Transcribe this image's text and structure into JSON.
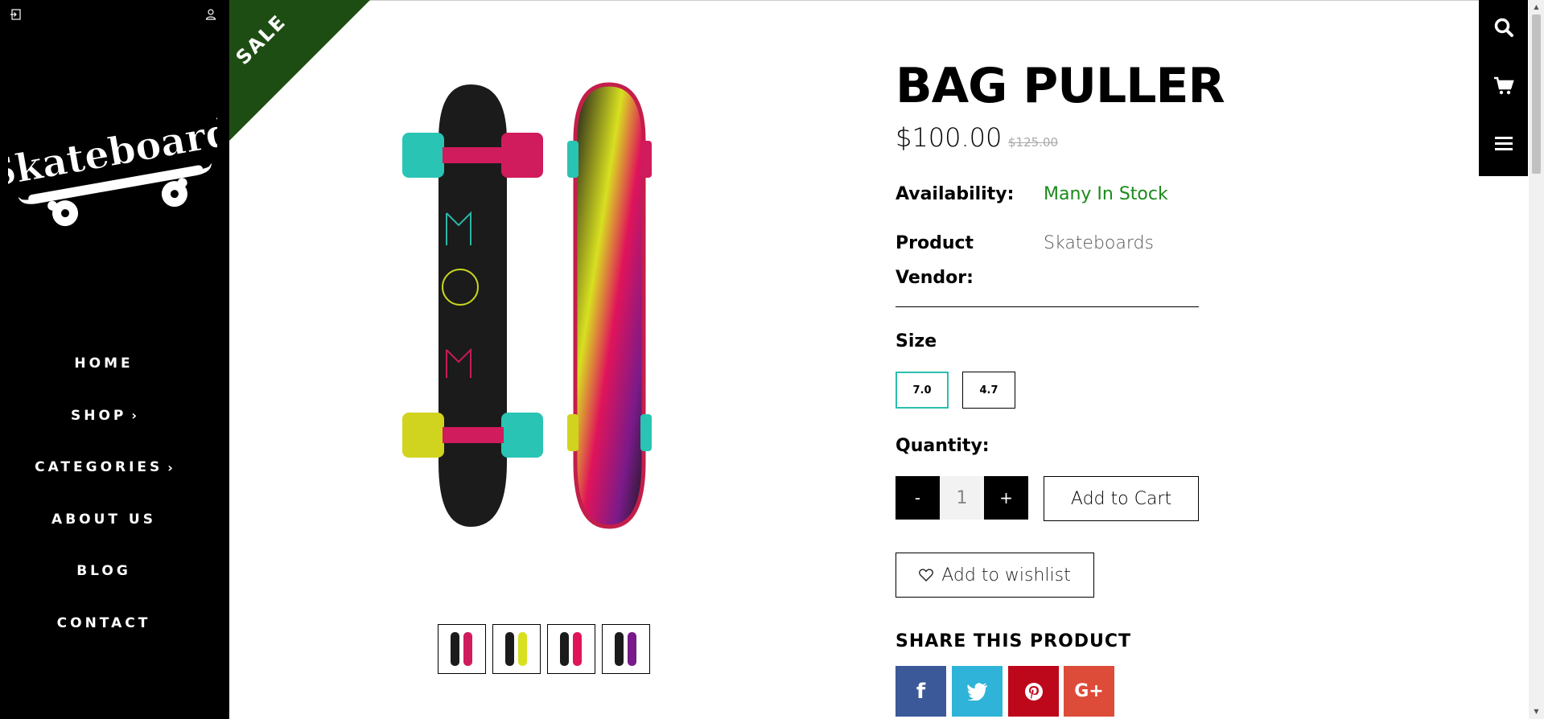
{
  "sidebar": {
    "logo_text": "Skateboard",
    "nav": [
      {
        "label": "HOME",
        "has_submenu": false
      },
      {
        "label": "SHOP",
        "has_submenu": true
      },
      {
        "label": "CATEGORIES",
        "has_submenu": true
      },
      {
        "label": "ABOUT US",
        "has_submenu": false
      },
      {
        "label": "BLOG",
        "has_submenu": false
      },
      {
        "label": "CONTACT",
        "has_submenu": false
      }
    ],
    "icons": [
      "login-icon",
      "user-icon"
    ]
  },
  "ribbon": {
    "text": "SALE",
    "color": "#1e4d14"
  },
  "product": {
    "title": "BAG PULLER",
    "price": "$100.00",
    "old_price": "$125.00",
    "availability_label": "Availability:",
    "availability_value": "Many In Stock",
    "vendor_label": "Product Vendor:",
    "vendor_value": "Skateboards",
    "size_label": "Size",
    "sizes": [
      {
        "label": "7.0",
        "selected": true
      },
      {
        "label": "4.7",
        "selected": false
      }
    ],
    "quantity_label": "Quantity:",
    "quantity_value": "1",
    "minus_label": "-",
    "plus_label": "+",
    "add_to_cart": "Add to Cart",
    "add_to_wishlist": "Add to wishlist",
    "share_title": "SHARE THIS PRODUCT",
    "social": [
      {
        "name": "facebook",
        "glyph": "f",
        "color": "#3b5998"
      },
      {
        "name": "twitter",
        "glyph": "t",
        "color": "#2fb3d8"
      },
      {
        "name": "pinterest",
        "glyph": "p",
        "color": "#bd081c"
      },
      {
        "name": "google-plus",
        "glyph": "G+",
        "color": "#dd4b39"
      }
    ],
    "thumbnail_count": 4
  },
  "utility": {
    "icons": [
      "search-icon",
      "cart-icon",
      "menu-icon"
    ]
  },
  "colors": {
    "accent": "#2bbfae",
    "in_stock": "#1a8a1a",
    "sidebar_bg": "#000000"
  }
}
